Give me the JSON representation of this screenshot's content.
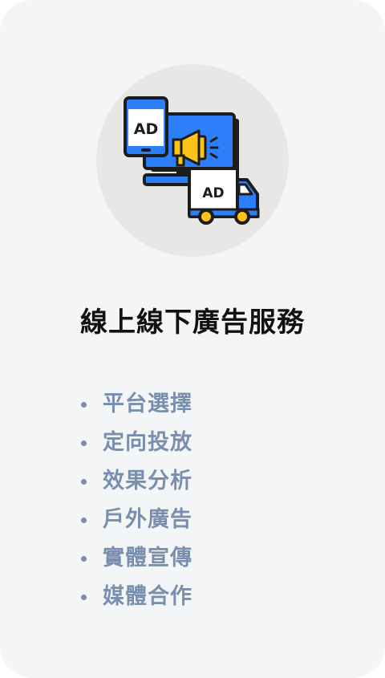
{
  "card": {
    "title": "線上線下廣告服務",
    "background_color": "#f4f5f7",
    "accent_color": "#7a8fae"
  },
  "illustration": {
    "icon": "advertising-icon",
    "phone_ad_label": "AD",
    "truck_ad_label": "AD",
    "colors": {
      "circle": "#e7e7e5",
      "blue": "#2d7ff9",
      "yellow": "#fcc419",
      "outline": "#1c1c1c"
    }
  },
  "services": {
    "items": [
      {
        "label": "平台選擇"
      },
      {
        "label": "定向投放"
      },
      {
        "label": "效果分析"
      },
      {
        "label": "戶外廣告"
      },
      {
        "label": "實體宣傳"
      },
      {
        "label": "媒體合作"
      }
    ]
  }
}
